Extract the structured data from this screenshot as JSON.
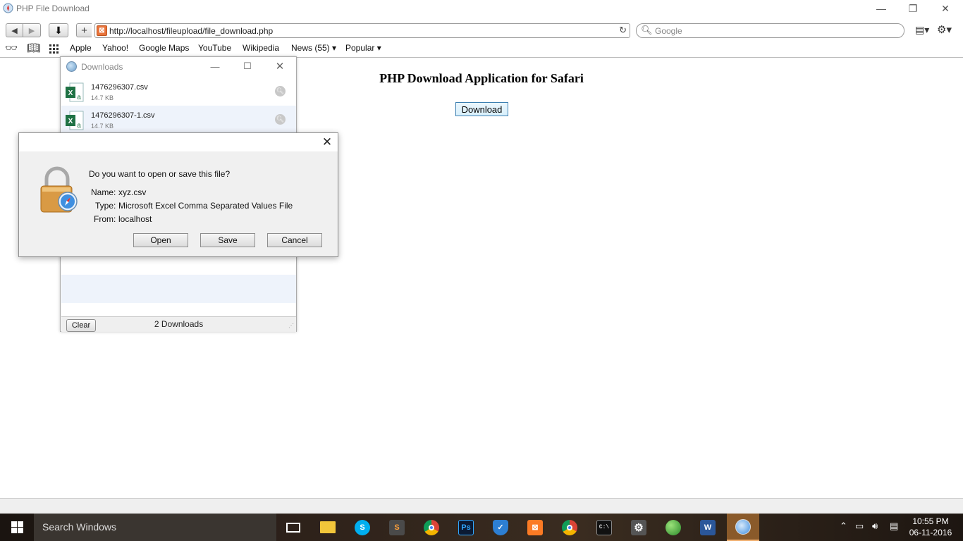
{
  "window": {
    "title": "PHP File Download",
    "minimize": "—",
    "restore": "❐",
    "close": "✕"
  },
  "toolbar": {
    "back": "◀",
    "forward": "▶",
    "downloads": "⬇",
    "add": "+",
    "url": "http://localhost/fileupload/file_download.php",
    "reload": "↻",
    "search_placeholder": "Google",
    "page_menu": "▤▾",
    "settings_menu": "⚙▾"
  },
  "bookmarks": {
    "items": [
      "Apple",
      "Yahoo!",
      "Google Maps",
      "YouTube",
      "Wikipedia",
      "News (55) ▾",
      "Popular ▾"
    ]
  },
  "page": {
    "heading": "PHP Download Application for Safari",
    "download_button": "Download"
  },
  "downloads_window": {
    "title": "Downloads",
    "items": [
      {
        "name": "1476296307.csv",
        "size": "14.7 KB"
      },
      {
        "name": "1476296307-1.csv",
        "size": "14.7 KB"
      }
    ],
    "clear_button": "Clear",
    "count": "2 Downloads"
  },
  "dialog": {
    "question": "Do you want to open or save this file?",
    "name_label": "Name:",
    "name_value": "xyz.csv",
    "type_label": "Type:",
    "type_value": "Microsoft Excel Comma Separated Values File",
    "from_label": "From:",
    "from_value": "localhost",
    "open_button": "Open",
    "save_button": "Save",
    "cancel_button": "Cancel"
  },
  "taskbar": {
    "search_placeholder": "Search Windows",
    "time": "10:55 PM",
    "date": "06-11-2016"
  }
}
